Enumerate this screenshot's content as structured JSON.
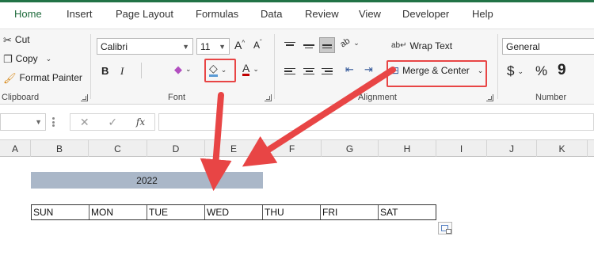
{
  "tabs": [
    "Home",
    "Insert",
    "Page Layout",
    "Formulas",
    "Data",
    "Review",
    "View",
    "Developer",
    "Help"
  ],
  "clipboard": {
    "cut": "Cut",
    "copy": "Copy",
    "format_painter": "Format Painter",
    "label": "Clipboard"
  },
  "font": {
    "name": "Calibri",
    "size": "11",
    "bold": "B",
    "italic": "I",
    "label": "Font"
  },
  "alignment": {
    "wrap_text": "Wrap Text",
    "merge_center": "Merge & Center",
    "label": "Alignment"
  },
  "number": {
    "format": "General",
    "currency": "$",
    "percent": "%",
    "comma": "9",
    "label": "Number"
  },
  "formula_bar": {
    "fx": "fx"
  },
  "columns": [
    "A",
    "B",
    "C",
    "D",
    "E",
    "F",
    "G",
    "H",
    "I",
    "J",
    "K"
  ],
  "sheet": {
    "merged_title": "2022",
    "days": [
      "SUN",
      "MON",
      "TUE",
      "WED",
      "THU",
      "FRI",
      "SAT"
    ]
  },
  "colors": {
    "accent": "#217346",
    "merged_fill": "#aab7c8",
    "highlight_red": "#e84545"
  }
}
